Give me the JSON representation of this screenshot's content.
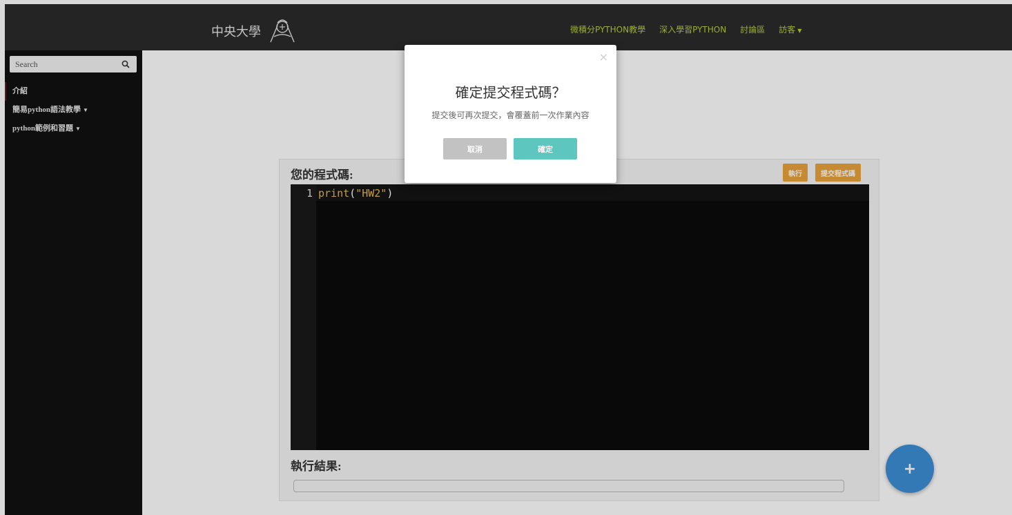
{
  "navbar": {
    "brand": "中央大學",
    "links": [
      {
        "label": "微積分PYTHON教學"
      },
      {
        "label": "深入學習PYTHON"
      },
      {
        "label": "討論區"
      },
      {
        "label": "訪客"
      }
    ]
  },
  "sidebar": {
    "search_placeholder": "Search",
    "items": [
      {
        "label": "介紹"
      },
      {
        "label": "簡易python語法教學"
      },
      {
        "label": "python範例和習題"
      }
    ]
  },
  "editor": {
    "title": "您的程式碼:",
    "run_label": "執行",
    "submit_label": "提交程式碼",
    "line_number": "1",
    "code_fn": "print",
    "code_open": "(",
    "code_str": "\"HW2\"",
    "code_close": ")",
    "result_title": "執行結果:"
  },
  "fab": {
    "label": "+"
  },
  "modal": {
    "close": "×",
    "title": "確定提交程式碼？",
    "text": "提交後可再次提交，會覆蓋前一次作業內容",
    "cancel_label": "取消",
    "confirm_label": "確定"
  },
  "colors": {
    "navbar_bg": "#2b2b2b",
    "nav_link": "#b5cd3a",
    "sidebar_bg": "#111111",
    "accent_orange": "#e8a33b",
    "confirm_teal": "#5cc6bf",
    "fab_blue": "#3b8fd6"
  }
}
